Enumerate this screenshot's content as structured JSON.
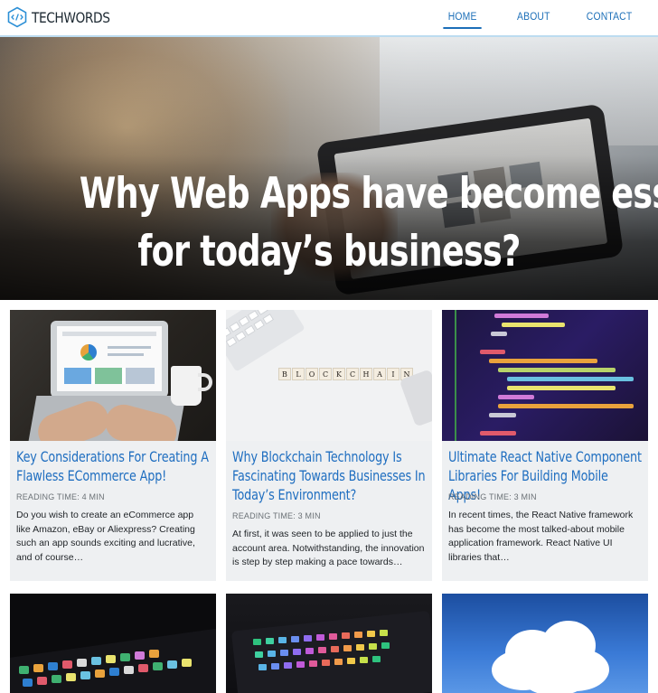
{
  "header": {
    "logo_text": "TECHWORDS",
    "nav": [
      {
        "label": "HOME",
        "active": true
      },
      {
        "label": "ABOUT",
        "active": false
      },
      {
        "label": "CONTACT",
        "active": false
      }
    ]
  },
  "hero": {
    "title_line1": "Why Web Apps have become essential",
    "title_line2": "for today’s business?"
  },
  "cards": [
    {
      "title": "Key Considerations For Creating A Flawless ECommerce App!",
      "reading_time": "READING TIME: 4 MIN",
      "excerpt": "Do you wish to create an eCommerce app like Amazon, eBay or Aliexpress? Creating such an app sounds exciting and lucrative, and of course…"
    },
    {
      "title": "Why Blockchain Technology Is Fascinating Towards Businesses In Today’s Environment?",
      "reading_time": "READING TIME: 3 MIN",
      "excerpt": "At first, it was seen to be applied to just the account area. Notwithstanding, the innovation is step by step making a pace towards…"
    },
    {
      "title": "Ultimate React Native Component Libraries For Building Mobile Apps!",
      "reading_time": "READING TIME: 3 MIN",
      "excerpt": "In recent times, the React Native framework has become the most talked-about mobile application framework. React Native UI libraries that…"
    }
  ],
  "thumb_text": {
    "blockchain_tiles": [
      "B",
      "L",
      "O",
      "C",
      "K",
      "C",
      "H",
      "A",
      "I",
      "N"
    ]
  },
  "colors": {
    "accent": "#1c6fb8",
    "card_bg": "#eef0f2",
    "title_link": "#1f6ec0"
  }
}
